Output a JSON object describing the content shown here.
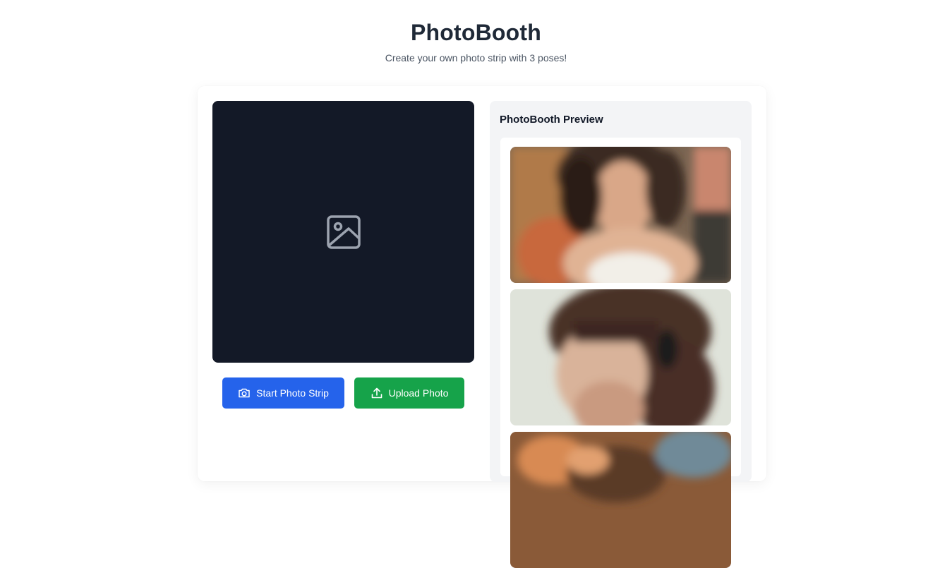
{
  "header": {
    "title": "PhotoBooth",
    "subtitle": "Create your own photo strip with 3 poses!"
  },
  "camera": {
    "placeholder_icon": "image-icon"
  },
  "actions": {
    "start_label": "Start Photo Strip",
    "start_icon": "camera-icon",
    "upload_label": "Upload Photo",
    "upload_icon": "upload-icon"
  },
  "preview": {
    "title": "PhotoBooth Preview",
    "photos": [
      {
        "description_icon": "photo-1"
      },
      {
        "description_icon": "photo-2"
      },
      {
        "description_icon": "photo-3"
      }
    ]
  },
  "colors": {
    "title": "#1f2937",
    "camera_bg": "#131927",
    "start_button": "#2563eb",
    "upload_button": "#16a34a",
    "preview_bg": "#f3f4f6"
  }
}
